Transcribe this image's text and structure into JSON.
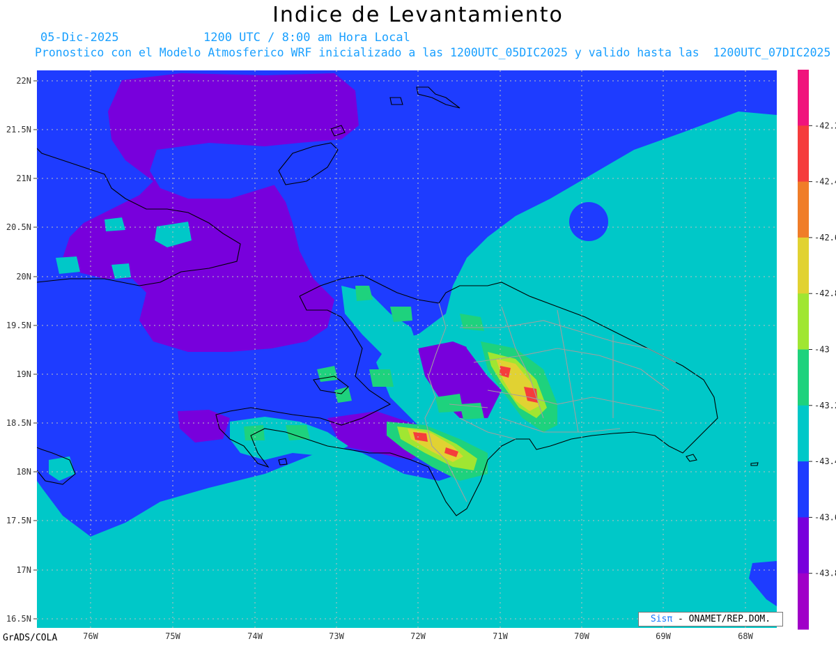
{
  "title": "Indice de Levantamiento",
  "date": "05-Dic-2025",
  "time": "1200 UTC / 8:00 am Hora Local",
  "subtitle": "Pronostico con el Modelo Atmosferico WRF inicializado a las 1200UTC_05DIC2025 y valido hasta las  1200UTC_07DIC2025",
  "lat_labels": [
    "22N",
    "21.5N",
    "21N",
    "20.5N",
    "20N",
    "19.5N",
    "19N",
    "18.5N",
    "18N",
    "17.5N",
    "17N",
    "16.5N"
  ],
  "lon_labels": [
    "76W",
    "75W",
    "74W",
    "73W",
    "72W",
    "71W",
    "70W",
    "69W",
    "68W"
  ],
  "colorbar": {
    "labels": [
      "-42.2",
      "-42.4",
      "-42.6",
      "-42.8",
      "-43",
      "-43.2",
      "-43.4",
      "-43.6",
      "-43.8"
    ],
    "colors": [
      "#f0147c",
      "#f53c3c",
      "#f07d28",
      "#e1d232",
      "#a0e632",
      "#1ed27d",
      "#00c8c8",
      "#1e3cff",
      "#7800dc",
      "#a000c8"
    ]
  },
  "credit_brand": "Sisπ",
  "credit_text": " - ONAMET/REP.DOM.",
  "software": "GrADS/COLA"
}
